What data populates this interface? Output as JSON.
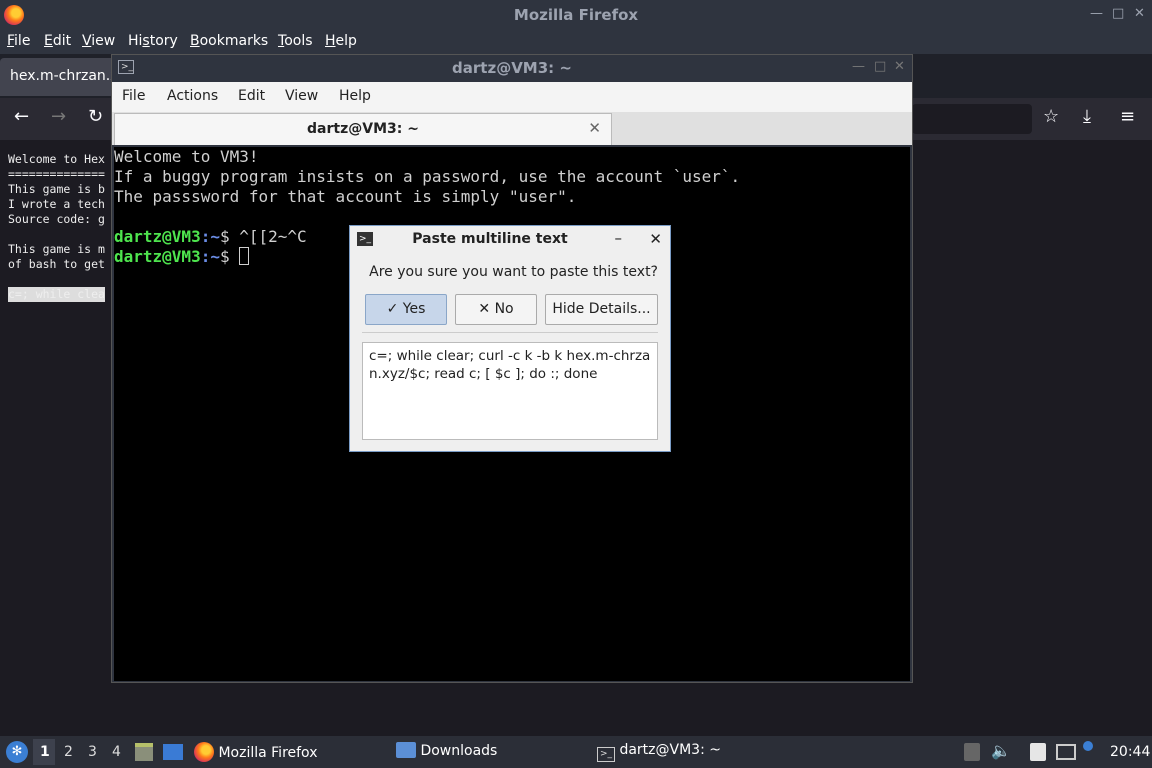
{
  "firefox": {
    "window_title": "Mozilla Firefox",
    "menu": [
      "File",
      "Edit",
      "View",
      "History",
      "Bookmarks",
      "Tools",
      "Help"
    ],
    "menu_underline": [
      "F",
      "E",
      "V",
      "s",
      "B",
      "T",
      "H"
    ],
    "tab_title": "hex.m-chrzan.x",
    "page_lines": [
      "Welcome to Hex",
      "==============",
      "This game is b",
      "I wrote a tech",
      "Source code: g",
      "",
      "This game is m",
      "of bash to get",
      "",
      "c=; while clea"
    ],
    "page_selected_line_index": 9
  },
  "terminal": {
    "window_title": "dartz@VM3: ~",
    "menu": [
      "File",
      "Actions",
      "Edit",
      "View",
      "Help"
    ],
    "tab_label": "dartz@VM3: ~",
    "lines": [
      "Welcome to VM3!",
      "If a buggy program insists on a password, use the account `user`.",
      "The passsword for that account is simply \"user\"."
    ],
    "prompt_user": "dartz@VM3",
    "prompt_path": ":~",
    "prompt_symbol": "$ ",
    "prompt1_cmd": "^[[2~^C",
    "prompt2_cmd": ""
  },
  "dialog": {
    "title": "Paste multiline text",
    "question": "Are you sure you want to paste this text?",
    "yes_label": "Yes",
    "no_label": "No",
    "details_label": "Hide Details...",
    "paste_text": "c=; while clear; curl -c k -b k hex.m-chrzan.xyz/$c; read c; [ $c ]; do :; done"
  },
  "taskbar": {
    "workspaces": [
      "1",
      "2",
      "3",
      "4"
    ],
    "active_workspace": "1",
    "tasks": [
      {
        "label": "Mozilla Firefox",
        "icon": "firefox-icon"
      },
      {
        "label": "Downloads",
        "icon": "folder-icon"
      },
      {
        "label": "dartz@VM3: ~",
        "icon": "terminal-icon"
      }
    ],
    "clock": "20:44"
  },
  "colors": {
    "prompt_user": "#4ee44e",
    "prompt_path": "#6b8de6",
    "dialog_accent": "#7a9cc6"
  }
}
